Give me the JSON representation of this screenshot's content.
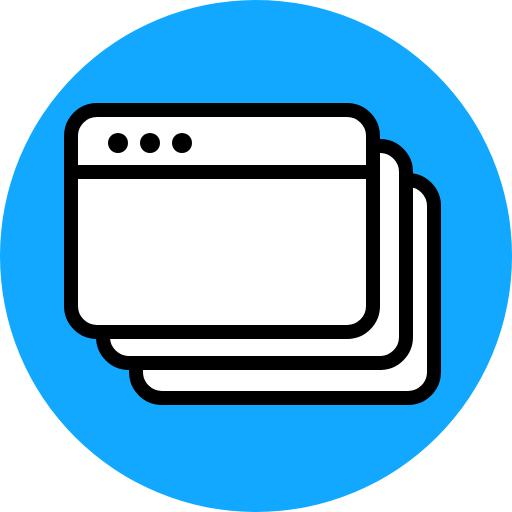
{
  "icon": {
    "name": "stacked-windows-icon",
    "background_color": "#13A8FF",
    "window_fill": "#FFFFFF",
    "outline_color": "#000000",
    "window_count": 3,
    "title_bar_dot_count": 3
  }
}
